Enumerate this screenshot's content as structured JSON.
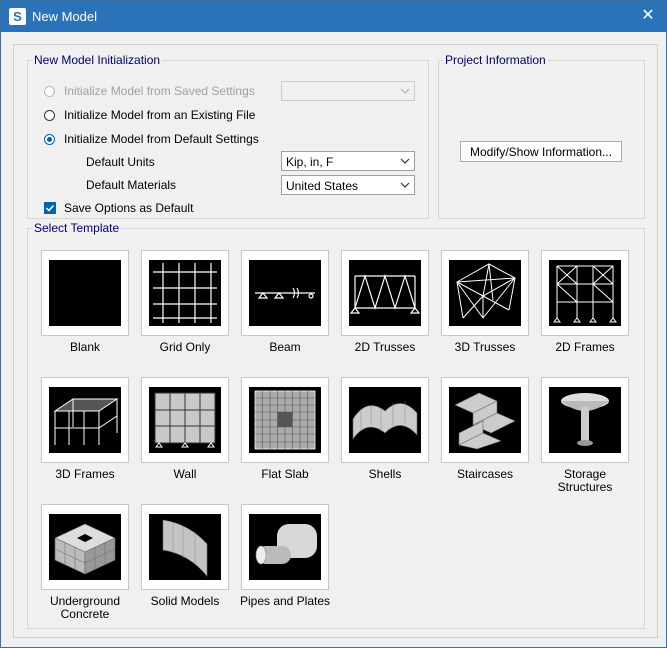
{
  "window": {
    "app_letter": "S",
    "title": "New Model",
    "close_glyph": "✕"
  },
  "init": {
    "legend": "New Model Initialization",
    "radio_saved": "Initialize Model from Saved Settings",
    "radio_existing": "Initialize Model from an Existing File",
    "radio_default": "Initialize Model from Default Settings",
    "selected_option": "default",
    "units_label": "Default Units",
    "units_value": "Kip, in, F",
    "materials_label": "Default Materials",
    "materials_value": "United States",
    "save_default_label": "Save Options as Default",
    "save_default_checked": true
  },
  "project": {
    "legend": "Project Information",
    "button": "Modify/Show Information..."
  },
  "templates": {
    "legend": "Select Template",
    "items": [
      {
        "label": "Blank",
        "icon": "blank-icon"
      },
      {
        "label": "Grid Only",
        "icon": "grid-icon"
      },
      {
        "label": "Beam",
        "icon": "beam-icon"
      },
      {
        "label": "2D Trusses",
        "icon": "truss-2d-icon"
      },
      {
        "label": "3D Trusses",
        "icon": "truss-3d-icon"
      },
      {
        "label": "2D Frames",
        "icon": "frame-2d-icon"
      },
      {
        "label": "3D Frames",
        "icon": "frame-3d-icon"
      },
      {
        "label": "Wall",
        "icon": "wall-icon"
      },
      {
        "label": "Flat Slab",
        "icon": "flat-slab-icon"
      },
      {
        "label": "Shells",
        "icon": "shells-icon"
      },
      {
        "label": "Staircases",
        "icon": "staircase-icon"
      },
      {
        "label": "Storage Structures",
        "icon": "storage-icon"
      },
      {
        "label": "Underground Concrete",
        "icon": "underground-icon"
      },
      {
        "label": "Solid Models",
        "icon": "solid-icon"
      },
      {
        "label": "Pipes and Plates",
        "icon": "pipes-icon"
      }
    ]
  },
  "colors": {
    "titlebar": "#2b73b8",
    "legend": "#00006e",
    "accent": "#0063b1"
  }
}
